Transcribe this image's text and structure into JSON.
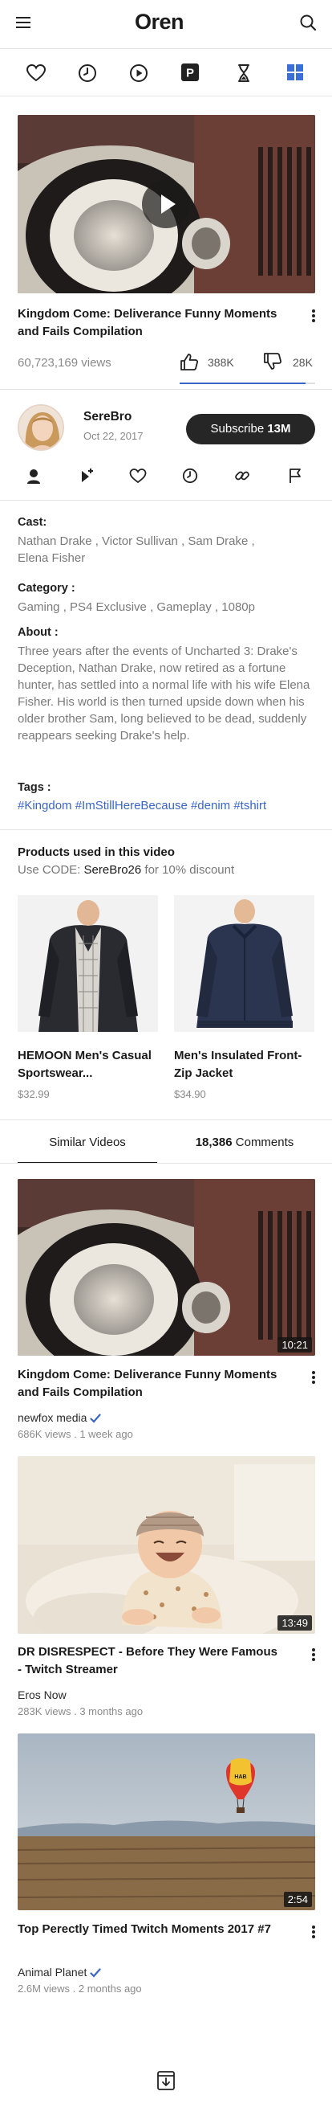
{
  "app": {
    "logo": "Oren"
  },
  "categories": [
    {
      "icon": "heart-icon"
    },
    {
      "icon": "clock-icon"
    },
    {
      "icon": "play-circle-icon"
    },
    {
      "icon": "p-square-icon",
      "label": "P"
    },
    {
      "icon": "hourglass-icon"
    },
    {
      "icon": "grid-icon",
      "active": true
    }
  ],
  "video": {
    "title": "Kingdom Come: Deliverance Funny Moments and Fails Compilation",
    "views": "60,723,169 views",
    "likes": "388K",
    "dislikes": "28K",
    "like_ratio": 0.93
  },
  "channel": {
    "name": "SereBro",
    "date": "Oct 22, 2017",
    "subscribe_label": "Subscribe",
    "subscribers": "13M"
  },
  "details": {
    "cast_label": "Cast:",
    "cast": "Nathan Drake , Victor Sullivan , Sam Drake , Elena Fisher",
    "category_label": "Category :",
    "category": "Gaming , PS4 Exclusive , Gameplay , 1080p",
    "about_label": "About :",
    "about": "Three years after the events of Uncharted 3: Drake's Deception, Nathan Drake, now retired as a fortune hunter, has settled into a normal life with his wife Elena Fisher. His world is then turned upside down when his older brother Sam, long believed to be dead, suddenly reappears seeking Drake's help.",
    "tags_label": "Tags :",
    "tags": [
      "#Kingdom",
      "#ImStillHereBecause",
      "#denim",
      "#tshirt"
    ]
  },
  "products": {
    "heading": "Products used in this video",
    "code_prefix": "Use CODE: ",
    "code": "SereBro26",
    "code_suffix": " for 10% discount",
    "items": [
      {
        "name": "HEMOON Men's Casual Sportswear...",
        "price": "$32.99"
      },
      {
        "name": "Men's Insulated Front-Zip Jacket",
        "price": "$34.90"
      }
    ]
  },
  "tabs": {
    "similar": "Similar Videos",
    "comments_count": "18,386",
    "comments_label": "Comments"
  },
  "similar_videos": [
    {
      "title": "Kingdom Come: Deliverance Funny Moments and Fails Compilation",
      "channel": "newfox media",
      "verified": true,
      "meta": "686K views . 1 week ago",
      "duration": "10:21"
    },
    {
      "title": "DR DISRESPECT - Before They Were Famous - Twitch Streamer",
      "channel": "Eros Now",
      "verified": false,
      "meta": "283K views . 3 months ago",
      "duration": "13:49"
    },
    {
      "title": "Top Perectly Timed Twitch Moments 2017 #7",
      "channel": "Animal Planet",
      "verified": true,
      "meta": "2.6M views . 2 months ago",
      "duration": "2:54"
    }
  ],
  "colors": {
    "accent": "#3a66c8",
    "active_icon": "#3b6fd8",
    "dark": "#262626"
  }
}
